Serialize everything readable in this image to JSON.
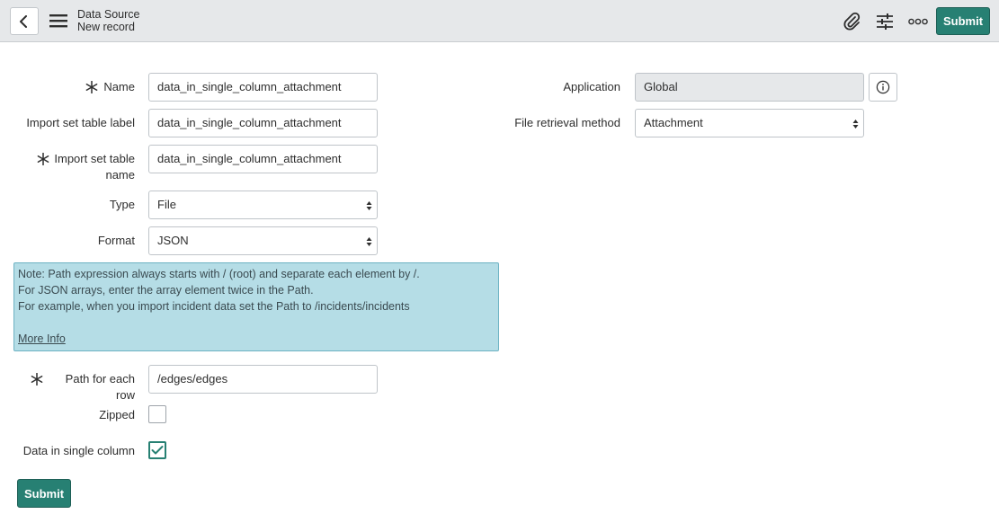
{
  "header": {
    "title": "Data Source",
    "subtitle": "New record",
    "submit_label": "Submit",
    "icons": [
      "back-icon",
      "hamburger-menu-icon",
      "paperclip-icon",
      "sliders-icon",
      "more-options-icon"
    ]
  },
  "form": {
    "name": {
      "label": "Name",
      "value": "data_in_single_column_attachment",
      "mandatory": true
    },
    "import_set_table_label": {
      "label": "Import set table label",
      "value": "data_in_single_column_attachment"
    },
    "import_set_table_name": {
      "label_line1": "Import set table",
      "label_line2": "name",
      "value": "data_in_single_column_attachment",
      "mandatory": true
    },
    "type": {
      "label": "Type",
      "value": "File"
    },
    "format": {
      "label": "Format",
      "value": "JSON"
    },
    "note": {
      "line1": "Note: Path expression always starts with / (root) and separate each element by /.",
      "line2": "For JSON arrays, enter the array element twice in the Path.",
      "line3": "For example, when you import incident data set the Path to /incidents/incidents",
      "link": "More Info"
    },
    "path_for_each_row": {
      "label": "Path for each row",
      "value": "/edges/edges",
      "mandatory": true
    },
    "zipped": {
      "label": "Zipped",
      "checked": false
    },
    "data_in_single_column": {
      "label": "Data in single column",
      "checked": true
    },
    "application": {
      "label": "Application",
      "value": "Global"
    },
    "file_retrieval_method": {
      "label": "File retrieval method",
      "value": "Attachment"
    },
    "submit_label": "Submit"
  },
  "colors": {
    "accent": "#278073",
    "header_bg": "#e6e8ea",
    "note_bg": "#b5dde6"
  }
}
